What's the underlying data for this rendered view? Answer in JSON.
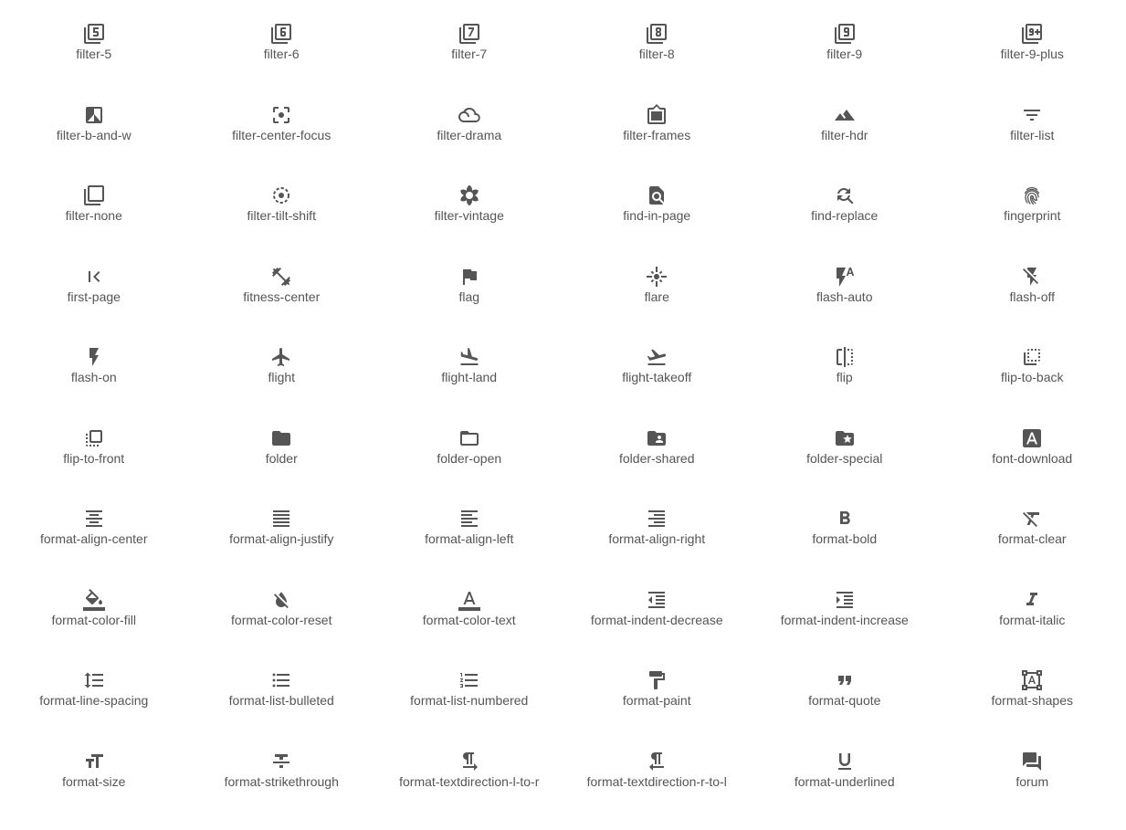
{
  "icon_color": "#555555",
  "label_color": "#555555",
  "icons": [
    {
      "label": "filter-5",
      "icon": "filter-5-icon"
    },
    {
      "label": "filter-6",
      "icon": "filter-6-icon"
    },
    {
      "label": "filter-7",
      "icon": "filter-7-icon"
    },
    {
      "label": "filter-8",
      "icon": "filter-8-icon"
    },
    {
      "label": "filter-9",
      "icon": "filter-9-icon"
    },
    {
      "label": "filter-9-plus",
      "icon": "filter-9-plus-icon"
    },
    {
      "label": "filter-b-and-w",
      "icon": "filter-b-and-w-icon"
    },
    {
      "label": "filter-center-focus",
      "icon": "filter-center-focus-icon"
    },
    {
      "label": "filter-drama",
      "icon": "filter-drama-icon"
    },
    {
      "label": "filter-frames",
      "icon": "filter-frames-icon"
    },
    {
      "label": "filter-hdr",
      "icon": "filter-hdr-icon"
    },
    {
      "label": "filter-list",
      "icon": "filter-list-icon"
    },
    {
      "label": "filter-none",
      "icon": "filter-none-icon"
    },
    {
      "label": "filter-tilt-shift",
      "icon": "filter-tilt-shift-icon"
    },
    {
      "label": "filter-vintage",
      "icon": "filter-vintage-icon"
    },
    {
      "label": "find-in-page",
      "icon": "find-in-page-icon"
    },
    {
      "label": "find-replace",
      "icon": "find-replace-icon"
    },
    {
      "label": "fingerprint",
      "icon": "fingerprint-icon"
    },
    {
      "label": "first-page",
      "icon": "first-page-icon"
    },
    {
      "label": "fitness-center",
      "icon": "fitness-center-icon"
    },
    {
      "label": "flag",
      "icon": "flag-icon"
    },
    {
      "label": "flare",
      "icon": "flare-icon"
    },
    {
      "label": "flash-auto",
      "icon": "flash-auto-icon"
    },
    {
      "label": "flash-off",
      "icon": "flash-off-icon"
    },
    {
      "label": "flash-on",
      "icon": "flash-on-icon"
    },
    {
      "label": "flight",
      "icon": "flight-icon"
    },
    {
      "label": "flight-land",
      "icon": "flight-land-icon"
    },
    {
      "label": "flight-takeoff",
      "icon": "flight-takeoff-icon"
    },
    {
      "label": "flip",
      "icon": "flip-icon"
    },
    {
      "label": "flip-to-back",
      "icon": "flip-to-back-icon"
    },
    {
      "label": "flip-to-front",
      "icon": "flip-to-front-icon"
    },
    {
      "label": "folder",
      "icon": "folder-icon"
    },
    {
      "label": "folder-open",
      "icon": "folder-open-icon"
    },
    {
      "label": "folder-shared",
      "icon": "folder-shared-icon"
    },
    {
      "label": "folder-special",
      "icon": "folder-special-icon"
    },
    {
      "label": "font-download",
      "icon": "font-download-icon"
    },
    {
      "label": "format-align-center",
      "icon": "format-align-center-icon"
    },
    {
      "label": "format-align-justify",
      "icon": "format-align-justify-icon"
    },
    {
      "label": "format-align-left",
      "icon": "format-align-left-icon"
    },
    {
      "label": "format-align-right",
      "icon": "format-align-right-icon"
    },
    {
      "label": "format-bold",
      "icon": "format-bold-icon"
    },
    {
      "label": "format-clear",
      "icon": "format-clear-icon"
    },
    {
      "label": "format-color-fill",
      "icon": "format-color-fill-icon"
    },
    {
      "label": "format-color-reset",
      "icon": "format-color-reset-icon"
    },
    {
      "label": "format-color-text",
      "icon": "format-color-text-icon"
    },
    {
      "label": "format-indent-decrease",
      "icon": "format-indent-decrease-icon"
    },
    {
      "label": "format-indent-increase",
      "icon": "format-indent-increase-icon"
    },
    {
      "label": "format-italic",
      "icon": "format-italic-icon"
    },
    {
      "label": "format-line-spacing",
      "icon": "format-line-spacing-icon"
    },
    {
      "label": "format-list-bulleted",
      "icon": "format-list-bulleted-icon"
    },
    {
      "label": "format-list-numbered",
      "icon": "format-list-numbered-icon"
    },
    {
      "label": "format-paint",
      "icon": "format-paint-icon"
    },
    {
      "label": "format-quote",
      "icon": "format-quote-icon"
    },
    {
      "label": "format-shapes",
      "icon": "format-shapes-icon"
    },
    {
      "label": "format-size",
      "icon": "format-size-icon"
    },
    {
      "label": "format-strikethrough",
      "icon": "format-strikethrough-icon"
    },
    {
      "label": "format-textdirection-l-to-r",
      "icon": "format-textdirection-l-to-r-icon"
    },
    {
      "label": "format-textdirection-r-to-l",
      "icon": "format-textdirection-r-to-l-icon"
    },
    {
      "label": "format-underlined",
      "icon": "format-underlined-icon"
    },
    {
      "label": "forum",
      "icon": "forum-icon"
    }
  ]
}
